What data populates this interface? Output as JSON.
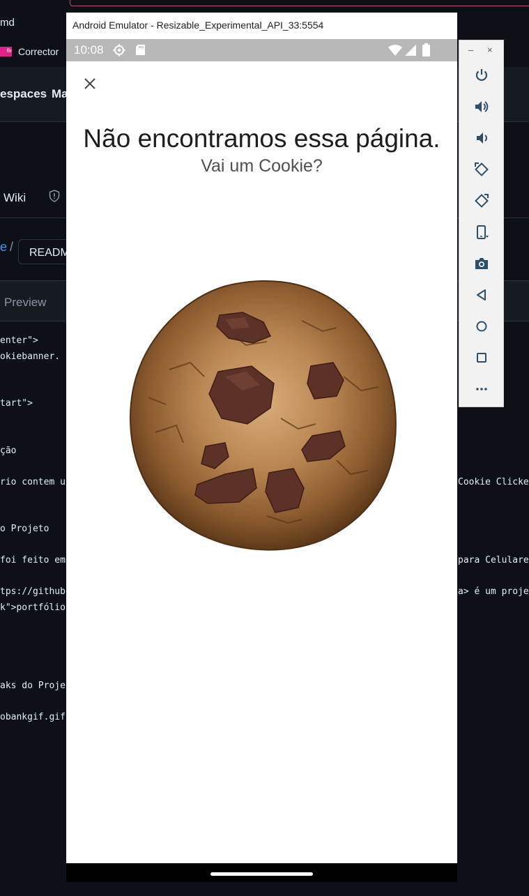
{
  "background": {
    "tab_title": "md",
    "bookmark_label": "Corrector",
    "nav_items": [
      "espaces",
      "Ma"
    ],
    "repo_tab_wiki": "Wiki",
    "breadcrumb_segment": "e",
    "breadcrumb_sep": "/",
    "file_name": "READM",
    "editor_tab": "Preview",
    "code_lines_left": [
      "enter\">",
      "okiebanner.",
      "tart\">",
      "ção",
      "rio contem u",
      "o Projeto",
      "foi feito em",
      "tps://github",
      "k\">portfólio",
      "aks do Proje",
      "obankgif.gif"
    ],
    "code_lines_right": [
      "Cookie Clicke",
      "para Celulare",
      "a> é um proje"
    ]
  },
  "emulator": {
    "window_title": "Android Emulator - Resizable_Experimental_API_33:5554",
    "status_bar": {
      "time": "10:08",
      "icons": [
        "settings-icon",
        "sd-card-icon",
        "wifi-icon",
        "signal-icon",
        "battery-icon"
      ]
    },
    "app": {
      "headline": "Não encontramos essa página.",
      "subheadline": "Vai um Cookie?",
      "close_icon": "close-icon",
      "image": "cookie-image"
    },
    "toolbar": {
      "minimize_label": "–",
      "close_label": "×",
      "buttons": [
        "power-icon",
        "volume-up-icon",
        "volume-down-icon",
        "rotate-left-icon",
        "rotate-right-icon",
        "fold-device-icon",
        "camera-icon",
        "back-icon",
        "home-icon",
        "overview-icon",
        "more-icon"
      ]
    }
  },
  "colors": {
    "page_bg": "#0d1117",
    "nav_bg": "#161b22",
    "link_blue": "#4493f8",
    "status_bar": "#b8b8b8",
    "cookie_dark": "#7a4e25",
    "chocolate": "#5b3128"
  }
}
